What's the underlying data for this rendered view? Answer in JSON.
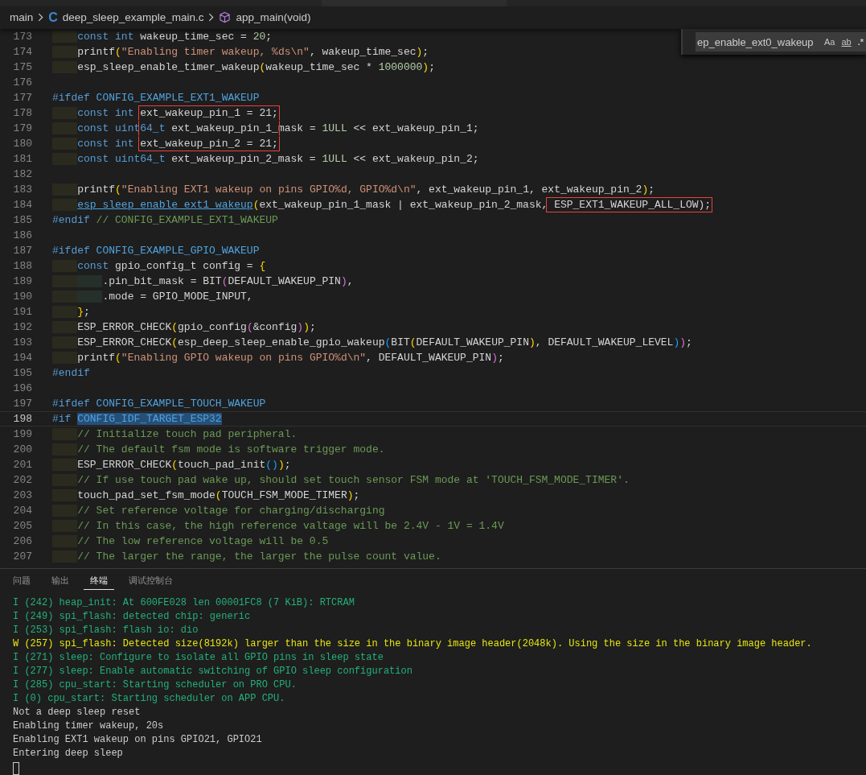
{
  "breadcrumb": {
    "items": [
      {
        "kind": "folder",
        "text": "main"
      },
      {
        "kind": "file",
        "icon_text": "C",
        "text": "deep_sleep_example_main.c"
      },
      {
        "kind": "symbol",
        "text": "app_main(void)"
      }
    ]
  },
  "find_widget": {
    "value": "ep_enable_ext0_wakeup",
    "options": [
      {
        "kind": "case",
        "label": "Aa",
        "selected": false
      },
      {
        "kind": "word",
        "label": "ab",
        "selected": false
      },
      {
        "kind": "regex",
        "label": ".*",
        "selected": false
      }
    ]
  },
  "editor": {
    "lines": [
      {
        "number": "173",
        "current": false,
        "tokens": [
          {
            "kind": "kw",
            "text": "    const int"
          },
          {
            "kind": "p",
            "text": " wakeup_time_sec = "
          },
          {
            "kind": "num",
            "text": "20"
          },
          {
            "kind": "p",
            "text": ";"
          }
        ]
      },
      {
        "number": "174",
        "current": false,
        "tokens": [
          {
            "kind": "p",
            "text": "    printf"
          },
          {
            "kind": "b1",
            "text": "("
          },
          {
            "kind": "str",
            "text": "\"Enabling timer wakeup, %ds\\n\""
          },
          {
            "kind": "p",
            "text": ", wakeup_time_sec"
          },
          {
            "kind": "b1",
            "text": ")"
          },
          {
            "kind": "p",
            "text": ";"
          }
        ]
      },
      {
        "number": "175",
        "current": false,
        "tokens": [
          {
            "kind": "p",
            "text": "    esp_sleep_enable_timer_wakeup"
          },
          {
            "kind": "b1",
            "text": "("
          },
          {
            "kind": "p",
            "text": "wakeup_time_sec * "
          },
          {
            "kind": "num",
            "text": "1000000"
          },
          {
            "kind": "b1",
            "text": ")"
          },
          {
            "kind": "p",
            "text": ";"
          }
        ]
      },
      {
        "number": "176",
        "current": false
      },
      {
        "number": "177",
        "current": false,
        "tokens": [
          {
            "kind": "pp",
            "text": "#ifdef "
          },
          {
            "kind": "mac",
            "text": "CONFIG_EXAMPLE_EXT1_WAKEUP"
          }
        ]
      },
      {
        "number": "178",
        "current": false,
        "tokens": [
          {
            "kind": "kw",
            "text": "    const int "
          },
          {
            "kind": "p",
            "text": "ext_wakeup_pin_1 = 21;",
            "boxed": true
          }
        ]
      },
      {
        "number": "179",
        "current": false,
        "tokens": [
          {
            "kind": "kw",
            "text": "    const uint64_t"
          },
          {
            "kind": "p",
            "text": " ext_wakeup_pin_1_",
            "boxed": true
          },
          {
            "kind": "p",
            "text": "mask = "
          },
          {
            "kind": "num",
            "text": "1ULL"
          },
          {
            "kind": "p",
            "text": " << ext_wakeup_pin_1;"
          }
        ]
      },
      {
        "number": "180",
        "current": false,
        "tokens": [
          {
            "kind": "kw",
            "text": "    const int "
          },
          {
            "kind": "p",
            "text": "ext_wakeup_pin_2 = 21;",
            "boxed": true
          }
        ]
      },
      {
        "number": "181",
        "current": false,
        "tokens": [
          {
            "kind": "kw",
            "text": "    const uint64_t"
          },
          {
            "kind": "p",
            "text": " ext_wakeup_pin_2_mask = "
          },
          {
            "kind": "num",
            "text": "1ULL"
          },
          {
            "kind": "p",
            "text": " << ext_wakeup_pin_2;"
          }
        ]
      },
      {
        "number": "182",
        "current": false
      },
      {
        "number": "183",
        "current": false,
        "tokens": [
          {
            "kind": "p",
            "text": "    printf"
          },
          {
            "kind": "b1",
            "text": "("
          },
          {
            "kind": "str",
            "text": "\"Enabling EXT1 wakeup on pins GPIO%d, GPIO%d\\n\""
          },
          {
            "kind": "p",
            "text": ", ext_wakeup_pin_1, ext_wakeup_pin_2"
          },
          {
            "kind": "b1",
            "text": ")"
          },
          {
            "kind": "p",
            "text": ";"
          }
        ]
      },
      {
        "number": "184",
        "current": false,
        "tokens": [
          {
            "kind": "link",
            "text": "    esp_sleep_enable_ext1_wakeup"
          },
          {
            "kind": "b1",
            "text": "("
          },
          {
            "kind": "p",
            "text": "ext_wakeup_pin_1_mask | ext_wakeup_pin_2_mask,"
          },
          {
            "kind": "p",
            "text": " ESP_EXT1_WAKEUP_ALL_LOW);",
            "boxed": true
          }
        ]
      },
      {
        "number": "185",
        "current": false,
        "tokens": [
          {
            "kind": "pp",
            "text": "#endif "
          },
          {
            "kind": "com",
            "text": "// CONFIG_EXAMPLE_EXT1_WAKEUP"
          }
        ]
      },
      {
        "number": "186",
        "current": false
      },
      {
        "number": "187",
        "current": false,
        "tokens": [
          {
            "kind": "pp",
            "text": "#ifdef "
          },
          {
            "kind": "mac",
            "text": "CONFIG_EXAMPLE_GPIO_WAKEUP"
          }
        ]
      },
      {
        "number": "188",
        "current": false,
        "tokens": [
          {
            "kind": "kw",
            "text": "    const"
          },
          {
            "kind": "p",
            "text": " gpio_config_t config = "
          },
          {
            "kind": "b1",
            "text": "{"
          }
        ]
      },
      {
        "number": "189",
        "current": false,
        "tokens": [
          {
            "kind": "p",
            "text": "        .pin_bit_mask = BIT"
          },
          {
            "kind": "b2",
            "text": "("
          },
          {
            "kind": "p",
            "text": "DEFAULT_WAKEUP_PIN"
          },
          {
            "kind": "b2",
            "text": ")"
          },
          {
            "kind": "p",
            "text": ","
          }
        ]
      },
      {
        "number": "190",
        "current": false,
        "tokens": [
          {
            "kind": "p",
            "text": "        .mode = GPIO_MODE_INPUT,"
          }
        ]
      },
      {
        "number": "191",
        "current": false,
        "tokens": [
          {
            "kind": "b1",
            "text": "    }"
          },
          {
            "kind": "p",
            "text": ";"
          }
        ]
      },
      {
        "number": "192",
        "current": false,
        "tokens": [
          {
            "kind": "p",
            "text": "    ESP_ERROR_CHECK"
          },
          {
            "kind": "b1",
            "text": "("
          },
          {
            "kind": "p",
            "text": "gpio_config"
          },
          {
            "kind": "b2",
            "text": "("
          },
          {
            "kind": "p",
            "text": "&config"
          },
          {
            "kind": "b2",
            "text": ")"
          },
          {
            "kind": "b1",
            "text": ")"
          },
          {
            "kind": "p",
            "text": ";"
          }
        ]
      },
      {
        "number": "193",
        "current": false,
        "tokens": [
          {
            "kind": "p",
            "text": "    ESP_ERROR_CHECK"
          },
          {
            "kind": "b1",
            "text": "("
          },
          {
            "kind": "p",
            "text": "esp_deep_sleep_enable_gpio_wakeup"
          },
          {
            "kind": "b3",
            "text": "("
          },
          {
            "kind": "p",
            "text": "BIT"
          },
          {
            "kind": "b1",
            "text": "("
          },
          {
            "kind": "p",
            "text": "DEFAULT_WAKEUP_PIN"
          },
          {
            "kind": "b1",
            "text": ")"
          },
          {
            "kind": "p",
            "text": ", DEFAULT_WAKEUP_LEVEL"
          },
          {
            "kind": "b3",
            "text": ")"
          },
          {
            "kind": "b2",
            "text": ")"
          },
          {
            "kind": "p",
            "text": ";"
          }
        ]
      },
      {
        "number": "194",
        "current": false,
        "tokens": [
          {
            "kind": "p",
            "text": "    printf"
          },
          {
            "kind": "b1",
            "text": "("
          },
          {
            "kind": "str",
            "text": "\"Enabling GPIO wakeup on pins GPIO%d\\n\""
          },
          {
            "kind": "p",
            "text": ", DEFAULT_WAKEUP_PIN"
          },
          {
            "kind": "b2",
            "text": ")"
          },
          {
            "kind": "p",
            "text": ";"
          }
        ]
      },
      {
        "number": "195",
        "current": false,
        "tokens": [
          {
            "kind": "pp",
            "text": "#endif"
          }
        ]
      },
      {
        "number": "196",
        "current": false
      },
      {
        "number": "197",
        "current": false,
        "tokens": [
          {
            "kind": "pp",
            "text": "#ifdef "
          },
          {
            "kind": "mac",
            "text": "CONFIG_EXAMPLE_TOUCH_WAKEUP"
          }
        ]
      },
      {
        "number": "198",
        "current": true,
        "tokens": [
          {
            "kind": "pp",
            "text": "#if "
          },
          {
            "kind": "sel",
            "text": "CONFIG_IDF_TARGET_ESP32"
          }
        ]
      },
      {
        "number": "199",
        "current": false,
        "tokens": [
          {
            "kind": "com",
            "text": "    // Initialize touch pad peripheral."
          }
        ]
      },
      {
        "number": "200",
        "current": false,
        "tokens": [
          {
            "kind": "com",
            "text": "    // The default fsm mode is software trigger mode."
          }
        ]
      },
      {
        "number": "201",
        "current": false,
        "tokens": [
          {
            "kind": "p",
            "text": "    ESP_ERROR_CHECK"
          },
          {
            "kind": "b1",
            "text": "("
          },
          {
            "kind": "p",
            "text": "touch_pad_init"
          },
          {
            "kind": "b3",
            "text": "()"
          },
          {
            "kind": "b1",
            "text": ")"
          },
          {
            "kind": "p",
            "text": ";"
          }
        ]
      },
      {
        "number": "202",
        "current": false,
        "tokens": [
          {
            "kind": "com",
            "text": "    // If use touch pad wake up, should set touch sensor FSM mode at 'TOUCH_FSM_MODE_TIMER'."
          }
        ]
      },
      {
        "number": "203",
        "current": false,
        "tokens": [
          {
            "kind": "p",
            "text": "    touch_pad_set_fsm_mode"
          },
          {
            "kind": "b1",
            "text": "("
          },
          {
            "kind": "p",
            "text": "TOUCH_FSM_MODE_TIMER"
          },
          {
            "kind": "b1",
            "text": ")"
          },
          {
            "kind": "p",
            "text": ";"
          }
        ]
      },
      {
        "number": "204",
        "current": false,
        "tokens": [
          {
            "kind": "com",
            "text": "    // Set reference voltage for charging/discharging"
          }
        ]
      },
      {
        "number": "205",
        "current": false,
        "tokens": [
          {
            "kind": "com",
            "text": "    // In this case, the high reference valtage will be 2.4V - 1V = 1.4V"
          }
        ]
      },
      {
        "number": "206",
        "current": false,
        "tokens": [
          {
            "kind": "com",
            "text": "    // The low reference voltage will be 0.5"
          }
        ]
      },
      {
        "number": "207",
        "current": false,
        "tokens": [
          {
            "kind": "com",
            "text": "    // The larger the range, the larger the pulse count value."
          }
        ]
      }
    ]
  },
  "panel": {
    "tabs": [
      {
        "label": "问题",
        "selected": false
      },
      {
        "label": "输出",
        "selected": false
      },
      {
        "label": "终端",
        "selected": true
      },
      {
        "label": "调试控制台",
        "selected": false
      }
    ],
    "terminal_lines": [
      {
        "kind": "info",
        "text": "I (242) heap_init: At 600FE028 len 00001FC8 (7 KiB): RTCRAM"
      },
      {
        "kind": "info",
        "text": "I (249) spi_flash: detected chip: generic"
      },
      {
        "kind": "info",
        "text": "I (253) spi_flash: flash io: dio"
      },
      {
        "kind": "warn",
        "text": "W (257) spi_flash: Detected size(8192k) larger than the size in the binary image header(2048k). Using the size in the binary image header."
      },
      {
        "kind": "info",
        "text": "I (271) sleep: Configure to isolate all GPIO pins in sleep state"
      },
      {
        "kind": "info",
        "text": "I (277) sleep: Enable automatic switching of GPIO sleep configuration"
      },
      {
        "kind": "info",
        "text": "I (285) cpu_start: Starting scheduler on PRO CPU."
      },
      {
        "kind": "info",
        "text": "I (0) cpu_start: Starting scheduler on APP CPU."
      },
      {
        "kind": "plain",
        "text": "Not a deep sleep reset"
      },
      {
        "kind": "plain",
        "text": "Enabling timer wakeup, 20s"
      },
      {
        "kind": "plain",
        "text": "Enabling EXT1 wakeup on pins GPIO21, GPIO21"
      },
      {
        "kind": "plain",
        "text": "Entering deep sleep"
      }
    ]
  }
}
